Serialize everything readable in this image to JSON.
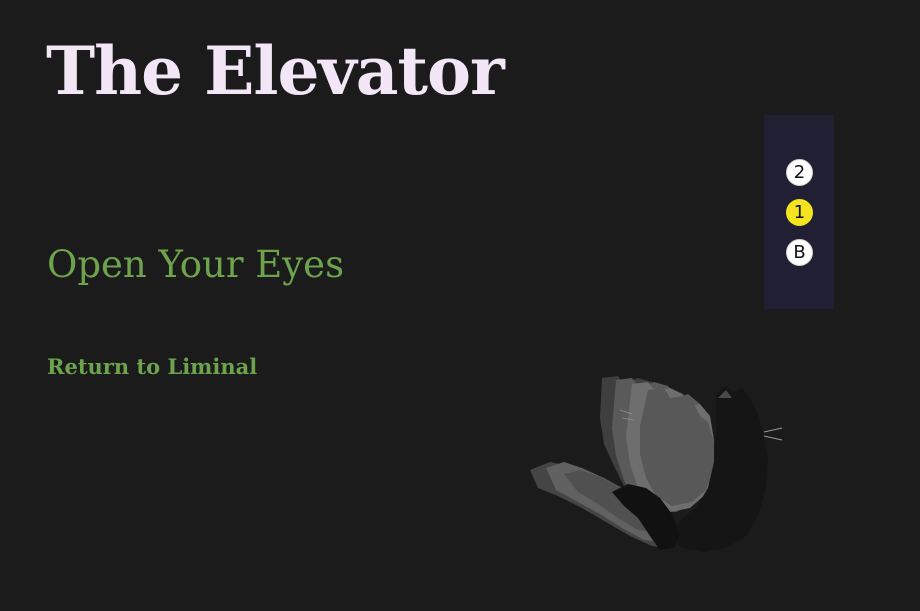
{
  "page": {
    "title": "The Elevator",
    "heading": "Open Your Eyes",
    "return_link": "Return to Liminal"
  },
  "elevator": {
    "floors": [
      {
        "label": "2",
        "active": false
      },
      {
        "label": "1",
        "active": true
      },
      {
        "label": "B",
        "active": false
      }
    ],
    "panel_color": "#201f33",
    "active_color": "#f4e41f"
  },
  "colors": {
    "background": "#1b1b1b",
    "title": "#f3e6f7",
    "accent": "#6da34d"
  },
  "illustration": {
    "icon": "cat-paws-icon"
  }
}
